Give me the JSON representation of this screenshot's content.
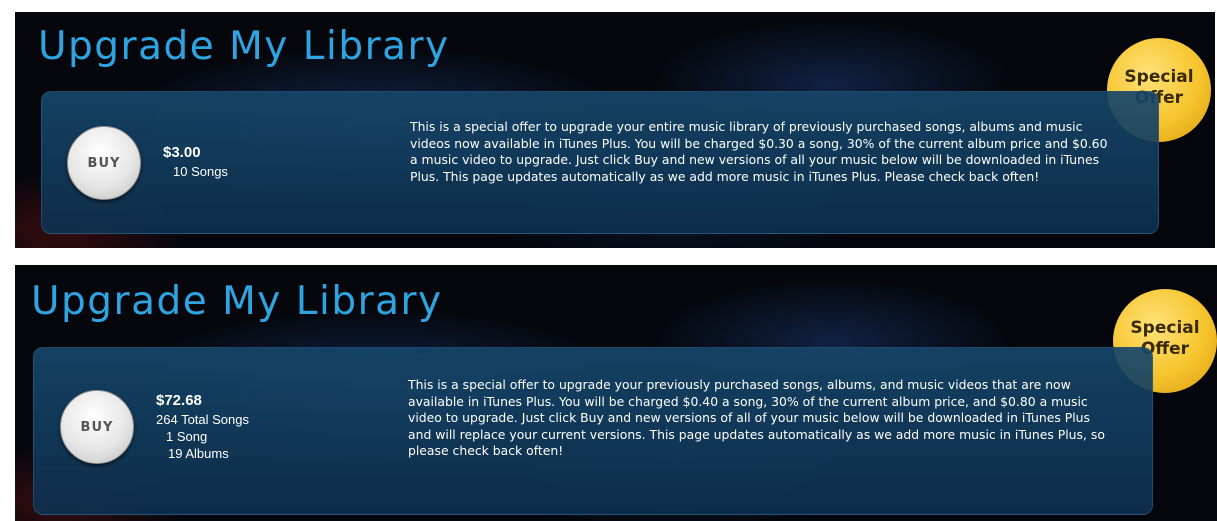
{
  "banners": [
    {
      "title": "Upgrade My Library",
      "buy_label": "BUY",
      "price": "$3.00",
      "details": [
        "10 Songs"
      ],
      "description": "This is a special offer to upgrade your entire music library of previously purchased songs, albums and music videos now available in iTunes Plus. You will be charged $0.30 a song, 30% of the current album price and $0.60 a music video to upgrade. Just click Buy and new versions of all your music below will be downloaded in iTunes Plus. This page updates automatically as we add more music in iTunes Plus. Please check back often!",
      "badge": [
        "Special",
        "Offer"
      ]
    },
    {
      "title": "Upgrade My Library",
      "buy_label": "BUY",
      "price": "$72.68",
      "details": [
        "264 Total Songs",
        "1 Song",
        "19 Albums"
      ],
      "description": "This is a special offer to upgrade your previously purchased songs, albums, and music videos that are now available in iTunes Plus. You will be charged $0.40 a song, 30% of the current album price, and $0.80 a music video to upgrade. Just click Buy and new versions of all of your music below will be downloaded in iTunes Plus and will replace your current versions. This page updates automatically as we add more music in iTunes Plus, so please check back often!",
      "badge": [
        "Special",
        "Offer"
      ]
    }
  ],
  "colors": {
    "title": "#2ea4e0",
    "panel": "#164669",
    "badge": "#f6c42c",
    "background": "#05070d"
  }
}
